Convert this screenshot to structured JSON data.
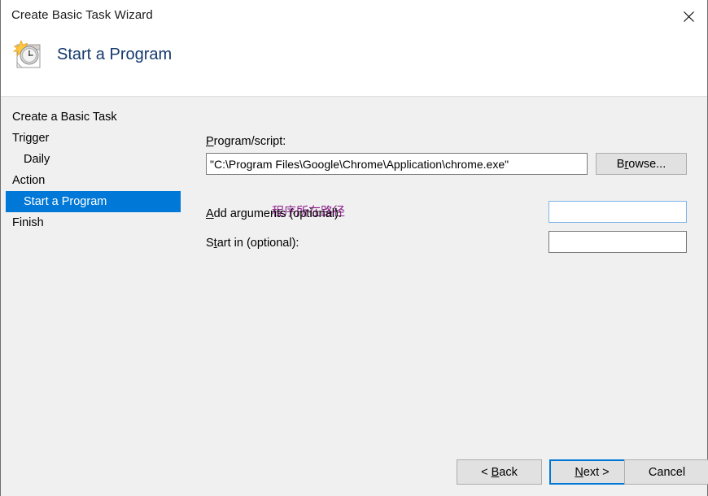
{
  "window": {
    "title": "Create Basic Task Wizard",
    "close_icon": "close-icon"
  },
  "header": {
    "title": "Start a Program",
    "icon": "task-scheduler-clock-icon"
  },
  "sidebar": {
    "items": [
      {
        "label": "Create a Basic Task",
        "indent": false,
        "selected": false
      },
      {
        "label": "Trigger",
        "indent": false,
        "selected": false
      },
      {
        "label": "Daily",
        "indent": true,
        "selected": false
      },
      {
        "label": "Action",
        "indent": false,
        "selected": false
      },
      {
        "label": "Start a Program",
        "indent": true,
        "selected": true
      },
      {
        "label": "Finish",
        "indent": false,
        "selected": false
      }
    ]
  },
  "annotation": {
    "text": "程序所在路径",
    "color": "#8b1f8b"
  },
  "form": {
    "program": {
      "label_pre": "P",
      "label_post": "rogram/script:",
      "value": "\"C:\\Program Files\\Google\\Chrome\\Application\\chrome.exe\"",
      "placeholder": ""
    },
    "browse": {
      "label_pre": "B",
      "label_mid": "r",
      "label_post": "owse..."
    },
    "arguments": {
      "label_pre": "A",
      "label_post": "dd arguments (optional):",
      "value": "",
      "placeholder": ""
    },
    "start_in": {
      "label_pre": "S",
      "label_mid": "t",
      "label_post": "art in (optional):",
      "value": "",
      "placeholder": ""
    }
  },
  "footer": {
    "back": {
      "pre": "< ",
      "accel": "B",
      "post": "ack"
    },
    "next": {
      "pre": "",
      "accel": "N",
      "post": "ext >"
    },
    "cancel": {
      "label": "Cancel"
    }
  },
  "colors": {
    "accent": "#0078d7",
    "header_title": "#14386e",
    "body_background": "#f0f0f0",
    "annotation": "#8b1f8b",
    "focus_border": "#7eb4ea"
  }
}
